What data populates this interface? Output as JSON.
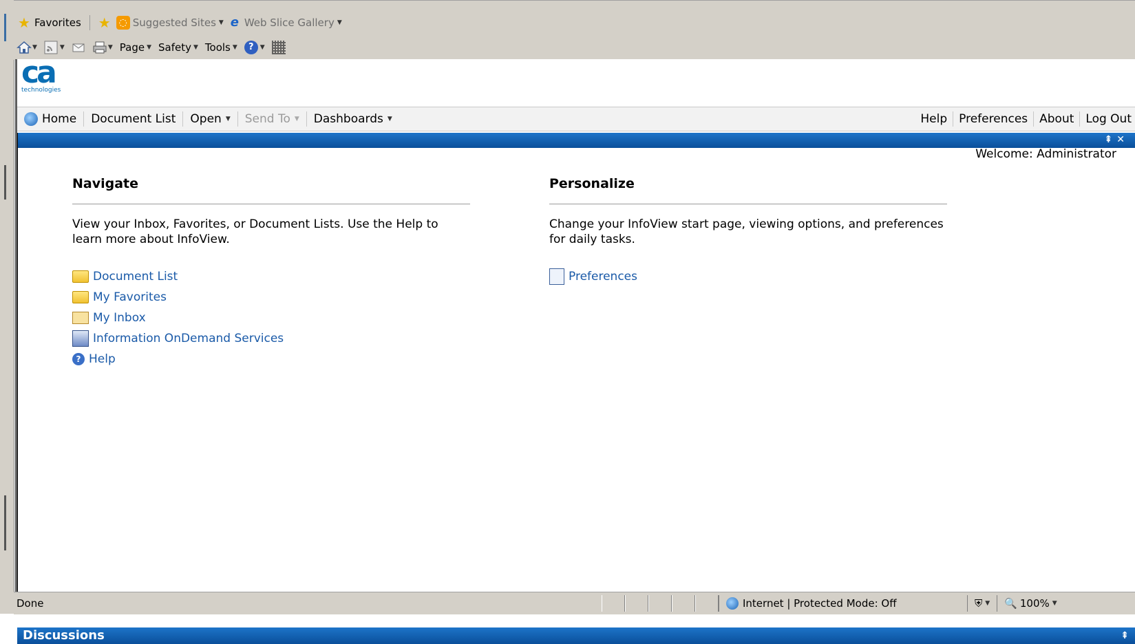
{
  "browser": {
    "favorites_bar": {
      "favorites_label": "Favorites",
      "suggested_sites_label": "Suggested Sites",
      "web_slice_label": "Web Slice Gallery"
    },
    "command_bar": {
      "page_label": "Page",
      "safety_label": "Safety",
      "tools_label": "Tools"
    },
    "status_bar": {
      "status_text": "Done",
      "zone_text": "Internet | Protected Mode: Off",
      "zoom_text": "100%"
    }
  },
  "app": {
    "logo": {
      "text": "ca",
      "subtext": "technologies"
    },
    "nav": {
      "home": "Home",
      "document_list": "Document List",
      "open": "Open",
      "send_to": "Send To",
      "dashboards": "Dashboards",
      "help": "Help",
      "preferences": "Preferences",
      "about": "About",
      "logout": "Log Out"
    },
    "welcome": {
      "label": "Welcome:",
      "user": "Administrator"
    },
    "navigate": {
      "title": "Navigate",
      "description": "View your Inbox, Favorites, or Document Lists. Use the Help to learn more about InfoView.",
      "links": [
        {
          "label": "Document List",
          "icon": "folder-icon"
        },
        {
          "label": "My Favorites",
          "icon": "favorites-folder-icon"
        },
        {
          "label": "My Inbox",
          "icon": "inbox-icon"
        },
        {
          "label": "Information OnDemand Services",
          "icon": "services-icon"
        },
        {
          "label": "Help",
          "icon": "help-icon"
        }
      ]
    },
    "personalize": {
      "title": "Personalize",
      "description": "Change your InfoView start page, viewing options, and preferences for daily tasks.",
      "links": [
        {
          "label": "Preferences",
          "icon": "preferences-icon"
        }
      ]
    },
    "discussions": {
      "title": "Discussions"
    }
  }
}
